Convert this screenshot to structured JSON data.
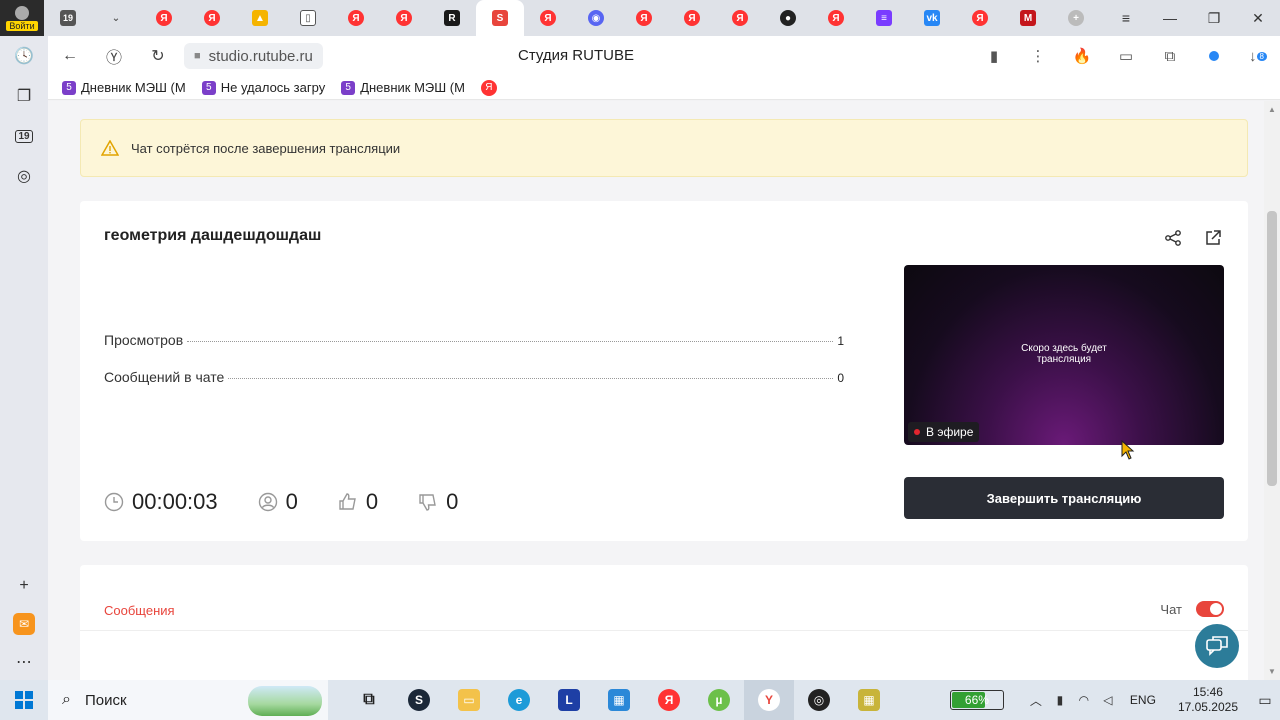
{
  "browser": {
    "login_label": "Войти",
    "url": "studio.rutube.ru",
    "page_title": "Студия RUTUBE",
    "tab_badge": "19",
    "sidebar_badge": "19",
    "downloads_count": "8",
    "bookmarks": [
      {
        "num": "5",
        "label": "Дневник МЭШ (М"
      },
      {
        "num": "5",
        "label": "Не удалось загру"
      },
      {
        "num": "5",
        "label": "Дневник МЭШ (М"
      }
    ],
    "bookmark_yandex": "Я"
  },
  "warning": {
    "text": "Чат сотрётся после завершения трансляции"
  },
  "stream": {
    "title": "геометрия дашдешдошдаш",
    "stats": [
      {
        "label": "Просмотров",
        "value": "1"
      },
      {
        "label": "Сообщений в чате",
        "value": "0"
      }
    ],
    "timer": "00:00:03",
    "viewers": "0",
    "likes": "0",
    "dislikes": "0",
    "preview_text_line1": "Скоро здесь будет",
    "preview_text_line2": "трансляция",
    "live_label": "В эфире",
    "end_button": "Завершить трансляцию"
  },
  "chat": {
    "messages_tab": "Сообщения",
    "chat_toggle_label": "Чат",
    "chat_enabled": true
  },
  "taskbar": {
    "search_placeholder": "Поиск",
    "battery_percent": "66%",
    "lang": "ENG",
    "time": "15:46",
    "date": "17.05.2025"
  },
  "colors": {
    "accent_red": "#e8453c",
    "warning_bg": "#fdf6d8",
    "end_button_bg": "#2a2d35",
    "help_fab": "#2c7c99"
  }
}
